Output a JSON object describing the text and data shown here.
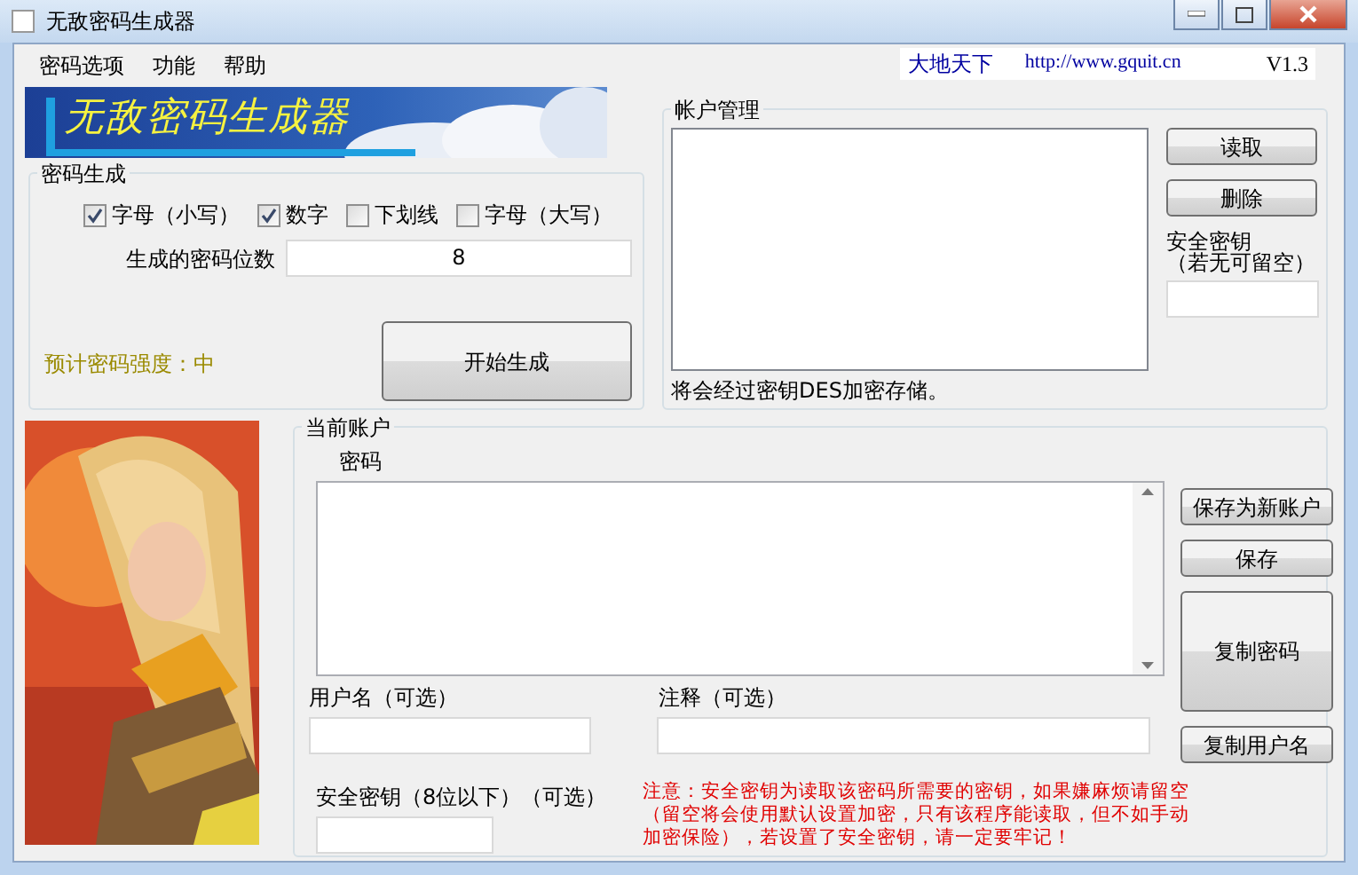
{
  "window": {
    "title": "无敌密码生成器"
  },
  "menu": [
    {
      "label": "密码选项"
    },
    {
      "label": "功能"
    },
    {
      "label": "帮助"
    }
  ],
  "header_info": {
    "author": "大地天下",
    "url": "http://www.gquit.cn",
    "version": "V1.3"
  },
  "banner": {
    "text": "无敌密码生成器"
  },
  "generation": {
    "title": "密码生成",
    "options": [
      {
        "label": "字母（小写）",
        "checked": true
      },
      {
        "label": "数字",
        "checked": true
      },
      {
        "label": "下划线",
        "checked": false
      },
      {
        "label": "字母（大写）",
        "checked": false
      }
    ],
    "length_label": "生成的密码位数",
    "length_value": "8",
    "strength": "预计密码强度：中",
    "generate_button": "开始生成"
  },
  "account_management": {
    "title": "帐户管理",
    "buttons": [
      {
        "label": "读取"
      },
      {
        "label": "删除"
      }
    ],
    "key_label": "安全密钥",
    "key_hint": "（若无可留空）",
    "note": "将会经过密钥DES加密存储。"
  },
  "current_account": {
    "title": "当前账户",
    "password_label": "密码",
    "buttons": [
      {
        "label": "保存为新账户"
      },
      {
        "label": "保存"
      },
      {
        "label": "复制密码"
      },
      {
        "label": "复制用户名"
      }
    ],
    "username_label": "用户名（可选）",
    "comment_label": "注释（可选）",
    "key_label": "安全密钥（8位以下）（可选）",
    "notice": "注意：安全密钥为读取该密码所需要的密钥，如果嫌麻烦请留空（留空将会使用默认设置加密，只有该程序能读取，但不如手动加密保险），若设置了安全密钥，请一定要牢记！"
  }
}
